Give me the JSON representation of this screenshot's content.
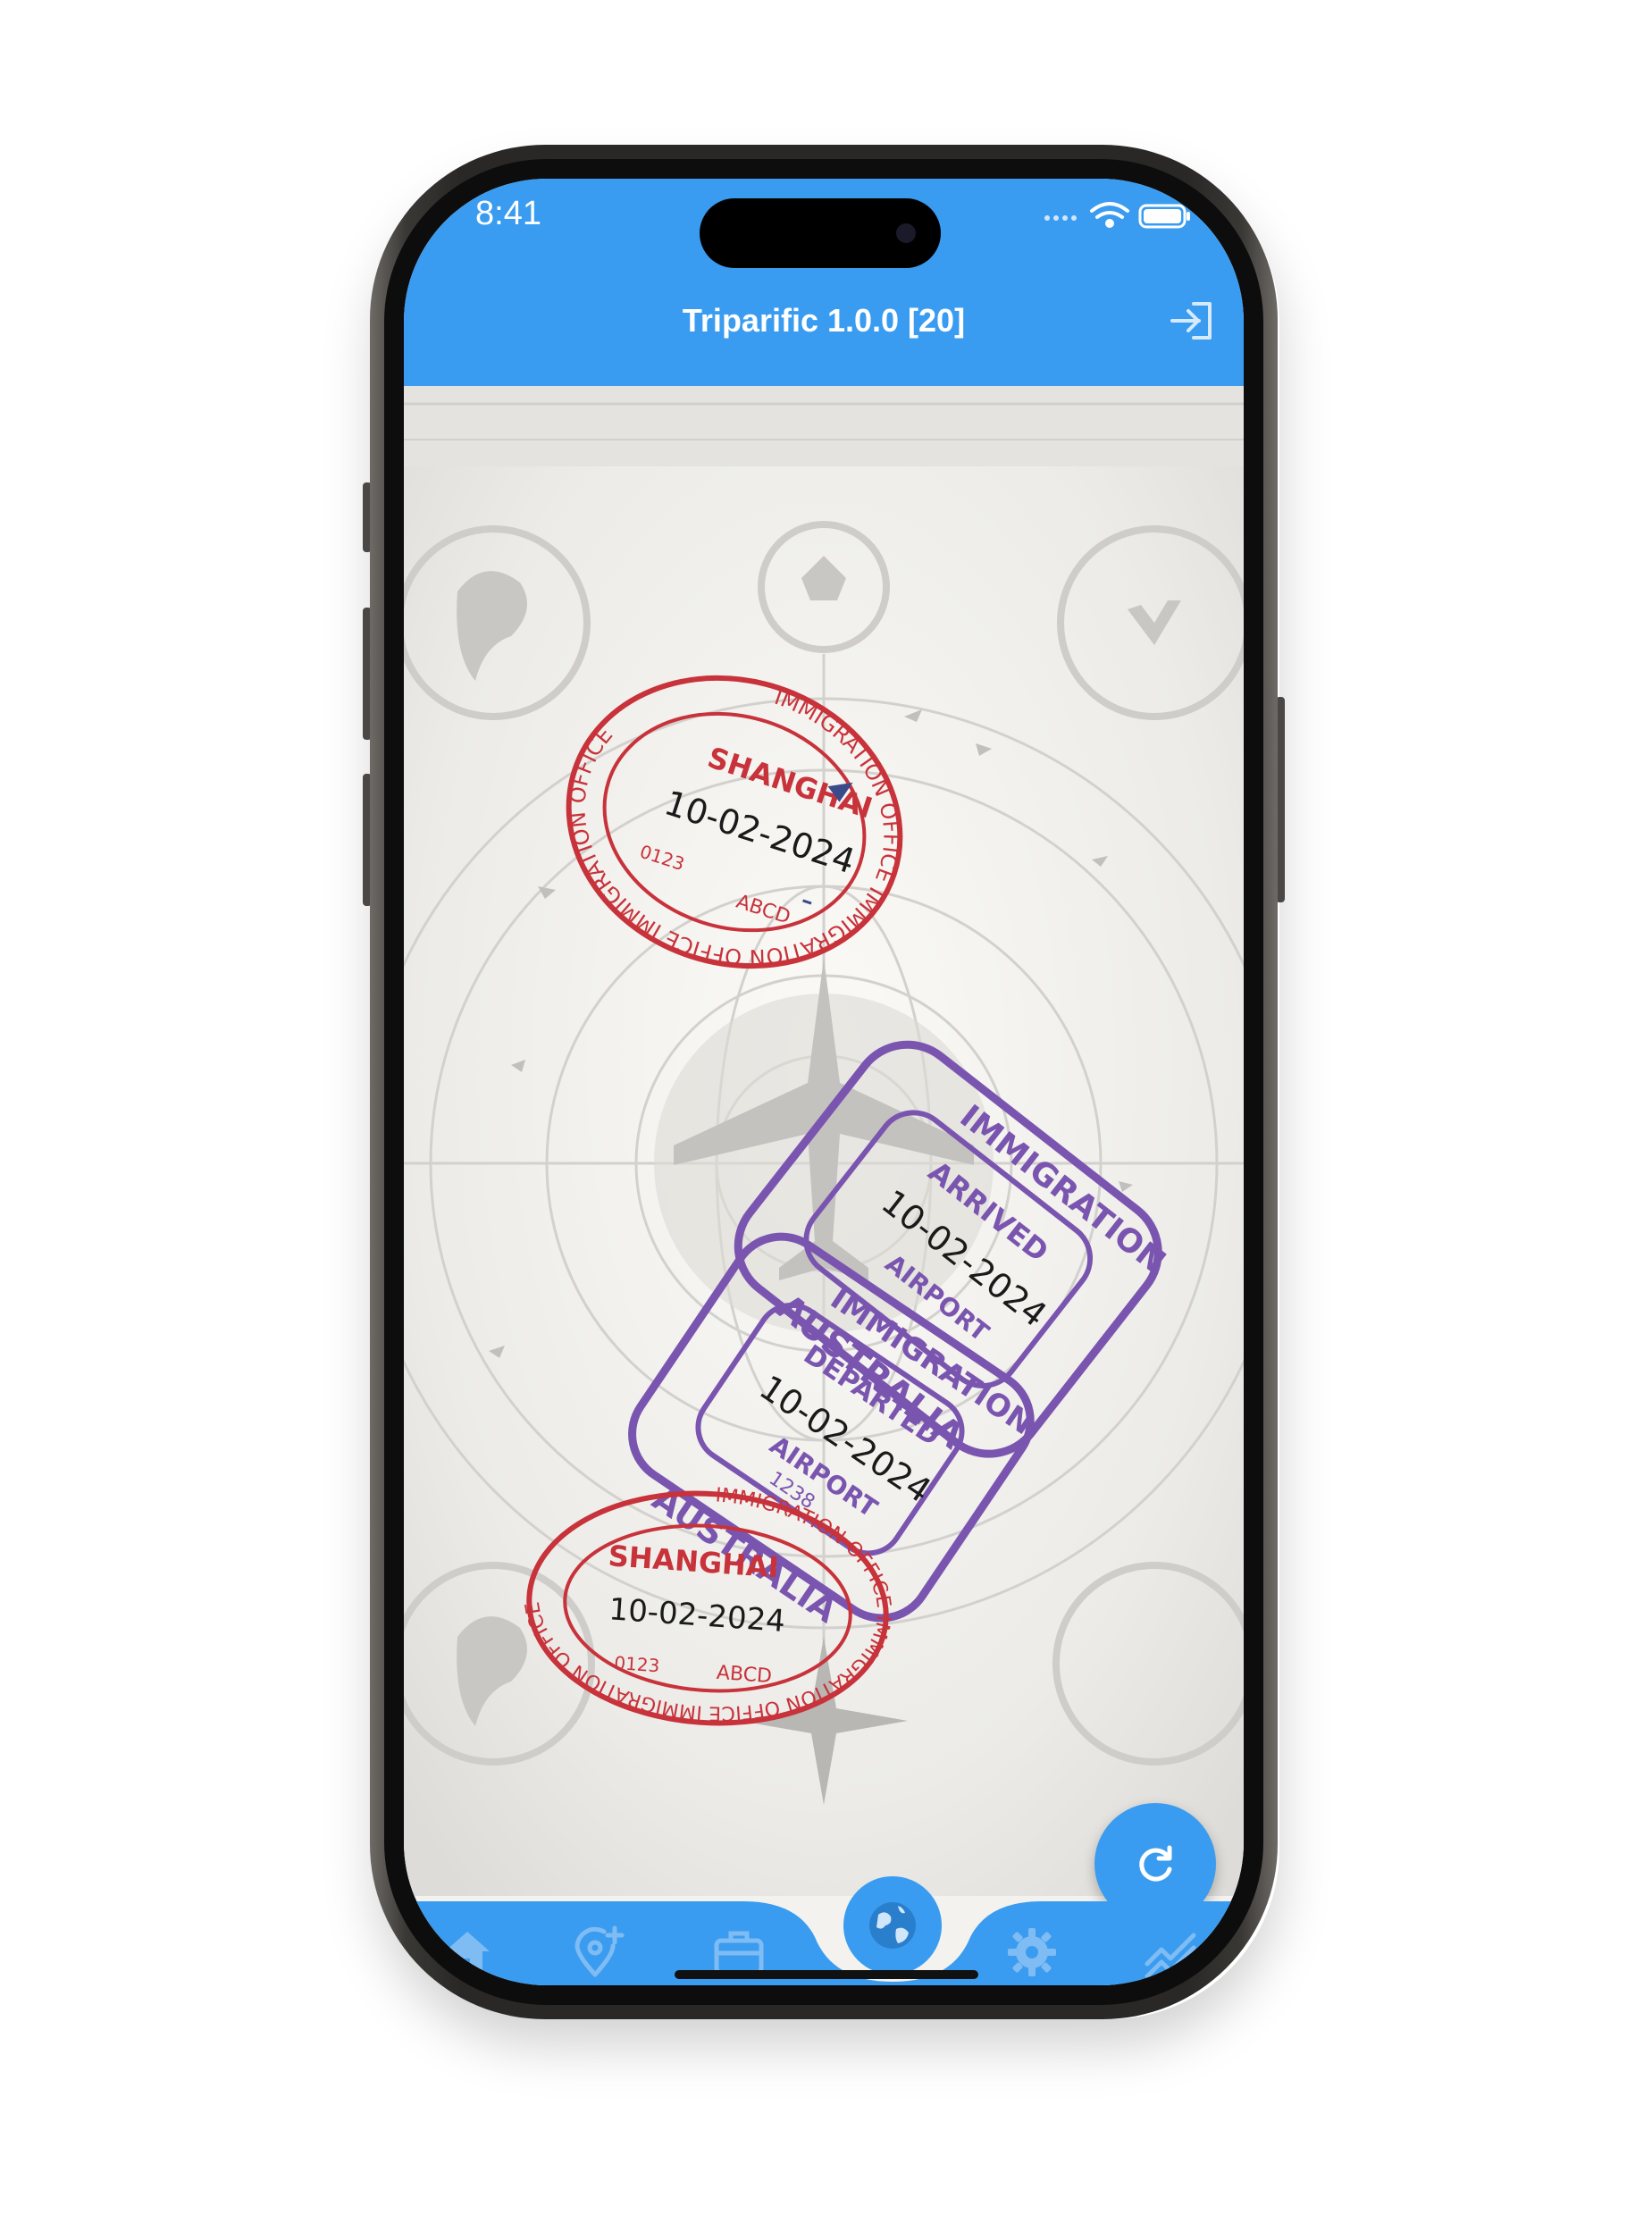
{
  "status_bar": {
    "time": "8:41"
  },
  "app_bar": {
    "title": "Triparific 1.0.0 [20]",
    "login_icon": "login-icon"
  },
  "stamps": {
    "shanghai_top": {
      "ring_text": "IMMIGRATION OFFICE IMMIGRATION OFFICE IMMIGRATION OFFICE",
      "city": "SHANGHAI",
      "date": "10-02-2024",
      "code": "0123",
      "letters": "ABCD"
    },
    "shanghai_bottom": {
      "ring_text": "IMMIGRATION OFFICE IMMIGRATION OFFICE IMMIGRATION OFFICE",
      "city": "SHANGHAI",
      "date": "10-02-2024",
      "code": "0123",
      "letters": "ABCD"
    },
    "australia_arrived": {
      "top": "IMMIGRATION",
      "status": "ARRIVED",
      "date": "10-02-2024",
      "place": "AIRPORT",
      "country": "AUSTRALIA"
    },
    "australia_departed": {
      "top": "IMMIGRATION",
      "status": "DEPARTED",
      "date": "10-02-2024",
      "place": "AIRPORT",
      "code": "1238",
      "country": "AUSTRALIA"
    }
  },
  "fab": {
    "icon": "refresh-icon"
  },
  "bottom_nav": {
    "items": [
      {
        "icon": "home-icon"
      },
      {
        "icon": "add-location-icon"
      },
      {
        "icon": "briefcase-icon"
      },
      {
        "icon": "globe-icon"
      },
      {
        "icon": "settings-icon"
      },
      {
        "icon": "stats-icon"
      }
    ]
  },
  "colors": {
    "primary": "#3a9cf0",
    "stamp_red": "#c8323a",
    "stamp_purple": "#7a55b0"
  }
}
